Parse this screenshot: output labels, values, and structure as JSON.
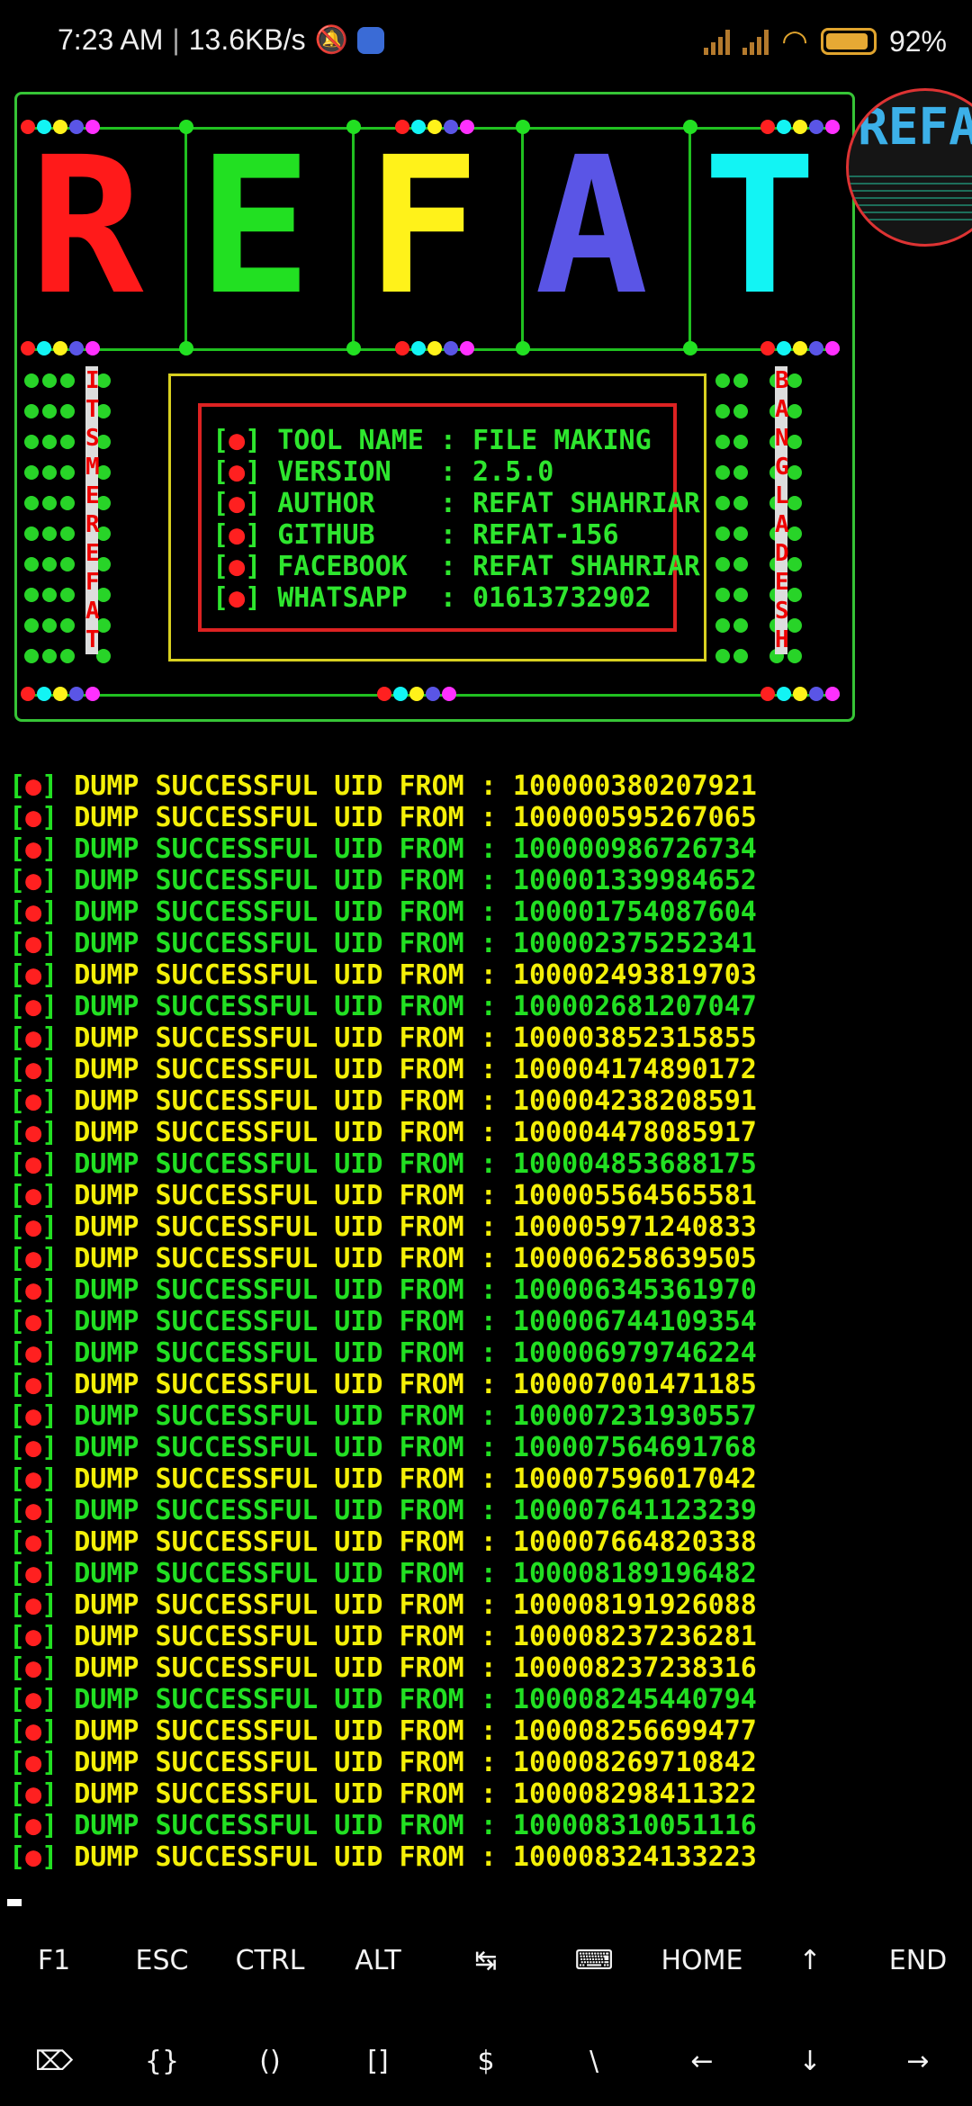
{
  "status_bar": {
    "time": "7:23 AM",
    "net_speed": "13.6KB/s",
    "battery": "92%",
    "icons": [
      "notifications-muted-icon",
      "messenger-icon",
      "signal-icon",
      "wifi-icon",
      "battery-icon"
    ]
  },
  "banner": {
    "letters": [
      "R",
      "E",
      "F",
      "A",
      "T"
    ],
    "letter_colors": [
      "#ff1a1a",
      "#22e022",
      "#fff21a",
      "#5a55e6",
      "#12f4f4"
    ],
    "left_vertical": "ITSMEREFAT",
    "right_vertical": "BANGLADESH",
    "info": [
      {
        "key": "TOOL NAME",
        "value": "FILE MAKING"
      },
      {
        "key": "VERSION  ",
        "value": "2.5.0"
      },
      {
        "key": "AUTHOR   ",
        "value": "REFAT SHAHRIAR"
      },
      {
        "key": "GITHUB   ",
        "value": "REFAT-156"
      },
      {
        "key": "FACEBOOK ",
        "value": "REFAT SHAHRIAR"
      },
      {
        "key": "WHATSAPP ",
        "value": "01613732902"
      }
    ],
    "logo_text": "REFAT"
  },
  "log": {
    "label": "DUMP SUCCESSFUL UID FROM",
    "rows": [
      {
        "uid": "100000380207921",
        "color": "yellow"
      },
      {
        "uid": "100000595267065",
        "color": "yellow"
      },
      {
        "uid": "100000986726734",
        "color": "green"
      },
      {
        "uid": "100001339984652",
        "color": "green"
      },
      {
        "uid": "100001754087604",
        "color": "green"
      },
      {
        "uid": "100002375252341",
        "color": "green"
      },
      {
        "uid": "100002493819703",
        "color": "yellow"
      },
      {
        "uid": "100002681207047",
        "color": "green"
      },
      {
        "uid": "100003852315855",
        "color": "yellow"
      },
      {
        "uid": "100004174890172",
        "color": "yellow"
      },
      {
        "uid": "100004238208591",
        "color": "yellow"
      },
      {
        "uid": "100004478085917",
        "color": "yellow"
      },
      {
        "uid": "100004853688175",
        "color": "green"
      },
      {
        "uid": "100005564565581",
        "color": "yellow"
      },
      {
        "uid": "100005971240833",
        "color": "yellow"
      },
      {
        "uid": "100006258639505",
        "color": "yellow"
      },
      {
        "uid": "100006345361970",
        "color": "green"
      },
      {
        "uid": "100006744109354",
        "color": "green"
      },
      {
        "uid": "100006979746224",
        "color": "green"
      },
      {
        "uid": "100007001471185",
        "color": "yellow"
      },
      {
        "uid": "100007231930557",
        "color": "green"
      },
      {
        "uid": "100007564691768",
        "color": "green"
      },
      {
        "uid": "100007596017042",
        "color": "yellow"
      },
      {
        "uid": "100007641123239",
        "color": "green"
      },
      {
        "uid": "100007664820338",
        "color": "yellow"
      },
      {
        "uid": "100008189196482",
        "color": "green"
      },
      {
        "uid": "100008191926088",
        "color": "yellow"
      },
      {
        "uid": "100008237236281",
        "color": "yellow"
      },
      {
        "uid": "100008237238316",
        "color": "yellow"
      },
      {
        "uid": "100008245440794",
        "color": "green"
      },
      {
        "uid": "100008256699477",
        "color": "yellow"
      },
      {
        "uid": "100008269710842",
        "color": "yellow"
      },
      {
        "uid": "100008298411322",
        "color": "yellow"
      },
      {
        "uid": "100008310051116",
        "color": "green"
      },
      {
        "uid": "100008324133223",
        "color": "yellow"
      }
    ]
  },
  "extra_keys": {
    "row1": [
      "F1",
      "ESC",
      "CTRL",
      "ALT",
      "↹",
      "⌨",
      "HOME",
      "↑",
      "END"
    ],
    "row2": [
      "⌦",
      "{}",
      "()",
      "[]",
      "$",
      "\\",
      "←",
      "↓",
      "→"
    ]
  }
}
